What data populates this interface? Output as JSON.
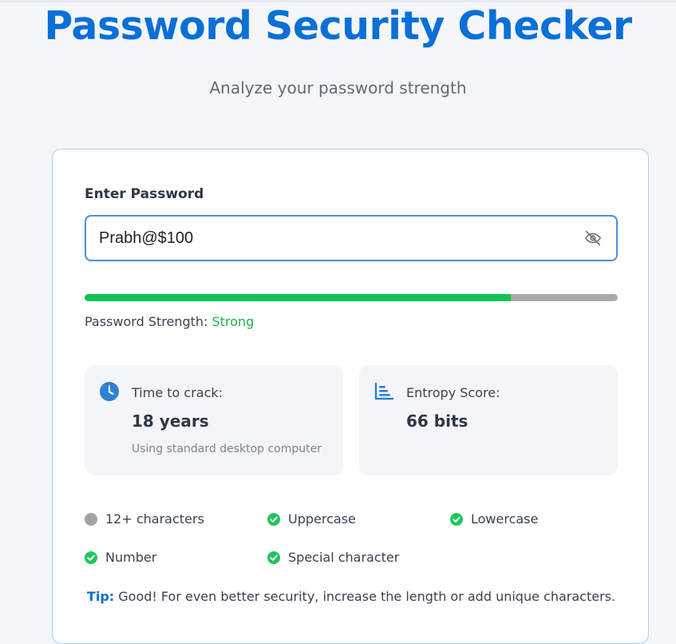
{
  "header": {
    "title": "Password Security Checker",
    "subtitle": "Analyze your password strength"
  },
  "form": {
    "label": "Enter Password",
    "value": "Prabh@$100",
    "toggle_icon": "eye-slash-icon"
  },
  "strength": {
    "label": "Password Strength:",
    "value": "Strong",
    "progress": 0.8,
    "fill_color": "#10c454",
    "track_color": "#a9a9a9"
  },
  "stats": [
    {
      "icon": "clock-icon",
      "label": "Time to crack:",
      "value": "18 years",
      "note": "Using standard desktop computer"
    },
    {
      "icon": "bar-chart-icon",
      "label": "Entropy Score:",
      "value": "66 bits"
    }
  ],
  "requirements": [
    {
      "label": "12+ characters",
      "met": false
    },
    {
      "label": "Uppercase",
      "met": true
    },
    {
      "label": "Lowercase",
      "met": true
    },
    {
      "label": "Number",
      "met": true
    },
    {
      "label": "Special character",
      "met": true
    }
  ],
  "tip": {
    "label": "Tip:",
    "text": " Good! For even better security, increase the length or add unique characters."
  },
  "colors": {
    "accent": "#0a6fd6",
    "success": "#21c55d",
    "unmet": "#a3a3a3"
  }
}
